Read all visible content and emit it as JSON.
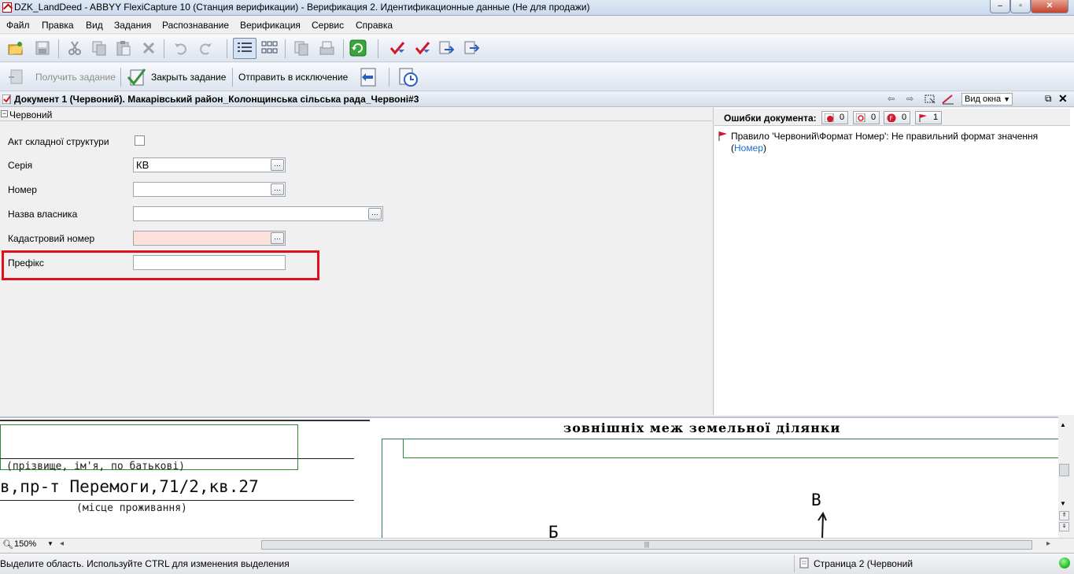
{
  "window": {
    "title": "DZK_LandDeed - ABBYY FlexiCapture 10 (Станция верификации) - Верификация 2. Идентификационные данные (Не для продажи)",
    "minimize": "–",
    "maximize": "▫",
    "close": "✕"
  },
  "menu": [
    "Файл",
    "Правка",
    "Вид",
    "Задания",
    "Распознавание",
    "Верификация",
    "Сервис",
    "Справка"
  ],
  "toolbar2": {
    "get_task": "Получить задание",
    "close_task": "Закрыть задание",
    "send_exception": "Отправить в исключение"
  },
  "document_header": {
    "title": "Документ 1 (Червоний). Макарівський район_Колонщинська сільська рада_Червоні#3",
    "view_label": "Вид окна"
  },
  "form": {
    "group_label": "Червоний",
    "fields": {
      "complex": {
        "label": "Акт складної структури",
        "checked": false
      },
      "series": {
        "label": "Серія",
        "value": "КВ"
      },
      "number": {
        "label": "Номер",
        "value": ""
      },
      "owner": {
        "label": "Назва власника",
        "value": ""
      },
      "cadastral": {
        "label": "Кадастровий номер",
        "value": ""
      },
      "prefix": {
        "label": "Префікс",
        "value": ""
      }
    }
  },
  "errors": {
    "header_label": "Ошибки документа:",
    "counts": {
      "critical": "0",
      "warnings": "0",
      "rules": "0",
      "flags": "1"
    },
    "message_text": "Правило 'Червоний\\Формат Номер': Не правильний формат значення",
    "message_open": "(",
    "message_link": "Номер",
    "message_close": ")"
  },
  "image_pane": {
    "line1": "(прізвище, ім'я, по батькові)",
    "line2": "в,пр-т Перемоги,71/2,кв.27",
    "line3": "(місце проживання)",
    "heading": "зовнішніх меж земельної ділянки",
    "letter_v": "В",
    "letter_b": "Б",
    "zoom": "150%"
  },
  "status": {
    "hint": "Выделите область. Используйте CTRL для изменения выделения",
    "page": "Страница 2 (Червоний"
  },
  "colors": {
    "highlight": "#e2101d",
    "cadastral_bg": "#fbe0dc",
    "link": "#1a6fd0",
    "status_ok": "#2bc02b"
  }
}
